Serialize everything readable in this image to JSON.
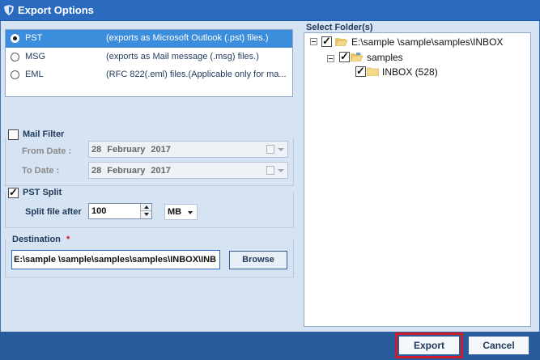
{
  "window": {
    "title": "Export Options",
    "icon": "app-shield-icon"
  },
  "formats": [
    {
      "name": "PST",
      "description": "(exports as Microsoft Outlook (.pst) files.)",
      "selected": true
    },
    {
      "name": "MSG",
      "description": "(exports as Mail message (.msg) files.)",
      "selected": false
    },
    {
      "name": "EML",
      "description": "(RFC 822(.eml) files.(Applicable only for ma...",
      "selected": false
    }
  ],
  "mail_filter": {
    "label": "Mail Filter",
    "checked": false,
    "from_label": "From Date :",
    "from_value": "28  February  2017",
    "to_label": "To Date :",
    "to_value": "28  February  2017"
  },
  "pst_split": {
    "label": "PST Split",
    "checked": true,
    "split_label": "Split file after",
    "split_value": "100",
    "unit": "MB"
  },
  "destination": {
    "label": "Destination",
    "required_mark": "*",
    "path": "E:\\sample  \\sample\\samples\\samples\\INBOX\\INB",
    "browse_label": "Browse"
  },
  "folders": {
    "label": "Select Folder(s)",
    "tree": [
      {
        "label": "E:\\sample \\sample\\samples\\INBOX",
        "checked": true,
        "level": 0
      },
      {
        "label": "samples",
        "checked": true,
        "level": 1
      },
      {
        "label": "INBOX (528)",
        "checked": true,
        "level": 2
      }
    ]
  },
  "footer": {
    "export_label": "Export",
    "cancel_label": "Cancel"
  },
  "colors": {
    "titlebar": "#2a6bbf",
    "panel": "#d6e3f2",
    "selected_row": "#3c8ddc",
    "footer": "#2a5c9c",
    "highlight": "#cc1b2b"
  }
}
